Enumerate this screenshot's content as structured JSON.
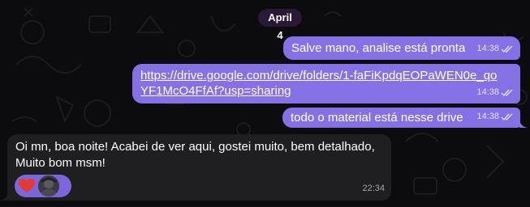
{
  "date_separator": "April 4",
  "messages": [
    {
      "text": "Salve mano, analise está pronta",
      "time": "14:38"
    },
    {
      "text": "https://drive.google.com/drive/folders/1-faFiKpdqEOPaWEN0e_qoYF1McO4FfAf?usp=sharing",
      "time": "14:38"
    },
    {
      "text": "todo o material está nesse drive",
      "time": "14:38"
    }
  ],
  "incoming": {
    "text": "Oi mn, boa noite! Acabei de ver aqui, gostei muito, bem detalhado, Muito bom msm!",
    "time": "22:34",
    "reactions": [
      "heart-icon",
      "reactor-avatar"
    ]
  },
  "colors": {
    "outgoing_bubble": "#8670e6",
    "incoming_bubble": "#1f1f22",
    "background": "#0c0c0e",
    "date_pill": "#2b1736",
    "reaction_pill": "#7d66d9",
    "heart": "#e53935"
  }
}
